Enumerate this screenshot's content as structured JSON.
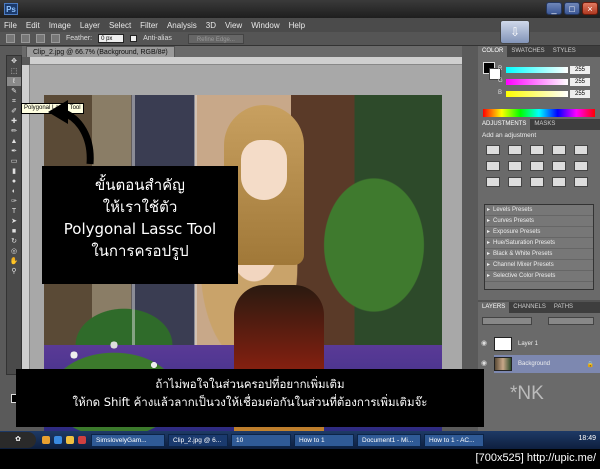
{
  "window": {
    "title": "Clip_2.jpg @ 66.7% (Background, RGB/8#)",
    "minimize_symbol": "_",
    "maximize_symbol": "□",
    "close_symbol": "×"
  },
  "menu": [
    "File",
    "Edit",
    "Image",
    "Layer",
    "Select",
    "Filter",
    "Analysis",
    "3D",
    "View",
    "Window",
    "Help"
  ],
  "options": {
    "feather_label": "Feather:",
    "feather_value": "0 px",
    "antialias_label": "Anti-alias",
    "refine_label": "Refine Edge..."
  },
  "doc_tab": "Clip_2.jpg @ 66.7% (Background, RGB/8#)",
  "tooltip": "Polygonal Lasso Tool",
  "callout": {
    "line1": "ขั้นตอนสำคัญ",
    "line2": "ให้เราใช้ตัว",
    "line3": "Polygonal Lassc Tool",
    "line4": "ในการครอปรูป"
  },
  "bottom_box": {
    "line1": "ถ้าไม่พอใจในส่วนครอปที่อยากเพิ่มเติม",
    "line2": "ให้กด Shift ค้างแล้วลากเป็นวงให้เชื่อมต่อกันในส่วนที่ต้องการเพิ่มเติมจ๊ะ"
  },
  "watermark_nk": "*NK",
  "panels": {
    "color_tabs": [
      "COLOR",
      "SWATCHES",
      "STYLES"
    ],
    "rgb_values": [
      "255",
      "255",
      "255"
    ],
    "adj_tabs": [
      "ADJUSTMENTS",
      "MASKS"
    ],
    "adj_title": "Add an adjustment",
    "presets": [
      "Levels Presets",
      "Curves Presets",
      "Exposure Presets",
      "Hue/Saturation Presets",
      "Black & White Presets",
      "Channel Mixer Presets",
      "Selective Color Presets"
    ],
    "layer_tabs": [
      "LAYERS",
      "CHANNELS",
      "PATHS"
    ],
    "layers": [
      "Layer 1",
      "Background"
    ]
  },
  "taskbar": {
    "tasks": [
      "SimslovelyGam...",
      "Clip_2.jpg @ 6...",
      "10",
      "How to 1",
      "Document1 - Mi...",
      "How to 1 - AC..."
    ],
    "clock": "18:49"
  },
  "footer_watermark": "[700x525] http://upic.me/",
  "colors": {
    "app_bg": "#5a5a5a",
    "panel_bg": "#6a6a6a",
    "taskbar": "#1e3a66",
    "callout_bg": "#000000"
  }
}
